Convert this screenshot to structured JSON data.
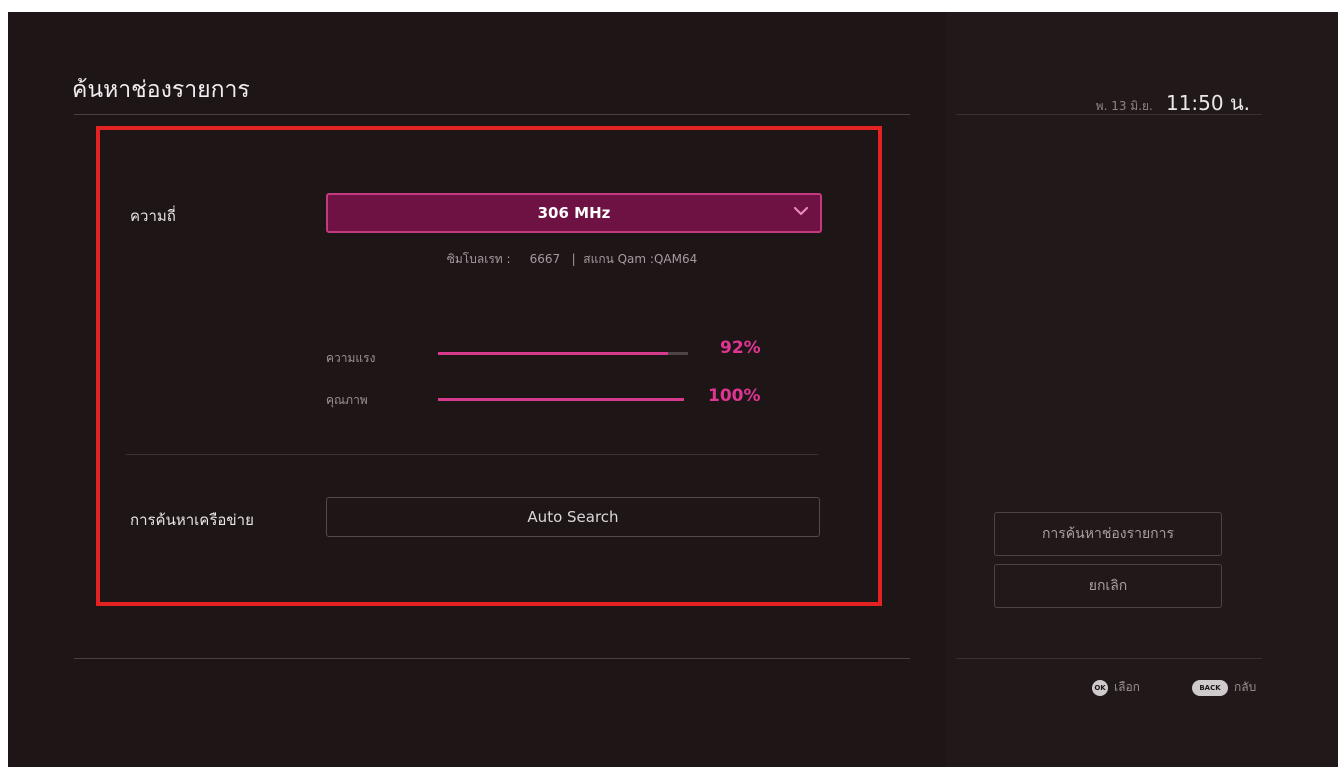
{
  "header": {
    "title": "ค้นหาช่องรายการ",
    "date": "พ. 13 มิ.ย.",
    "time": "11:50 น."
  },
  "form": {
    "frequency_label": "ความถี่",
    "frequency_value": "306 MHz",
    "info_line": "ซิมโบลเรท :     6667   |  สแกน Qam :QAM64",
    "strength_label": "ความแรง",
    "strength_value": "92%",
    "strength_level": 0.92,
    "quality_label": "คุณภาพ",
    "quality_value": "100%",
    "quality_level": 1.0,
    "network_search_label": "การค้นหาเครือข่าย",
    "auto_search_label": "Auto Search"
  },
  "side_panel": {
    "channel_search_button": "การค้นหาช่องรายการ",
    "cancel_button": "ยกเลิก"
  },
  "footer": {
    "ok_key": "OK",
    "ok_label": "เลือก",
    "back_key": "BACK",
    "back_label": "กลับ"
  },
  "colors": {
    "accent": "#d63a8c",
    "highlight_border": "#e52222",
    "dropdown_bg": "#6e1243",
    "background": "#1d1516"
  },
  "icons": {
    "dropdown": "chevron-down-icon"
  }
}
